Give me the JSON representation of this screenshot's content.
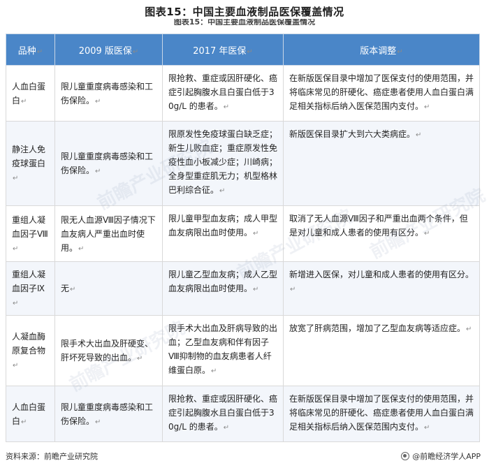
{
  "title": "图表15：中国主要血液制品医保覆盖情况",
  "subtitle": "图表15：中国主要血液制品医保覆盖情况",
  "table": {
    "headers": [
      "品种",
      "2009 版医保",
      "2017 年医保",
      "版本调整"
    ],
    "rows": [
      {
        "variety": "人血白蛋白",
        "v2009": "限儿童重度病毒感染和工伤保险。",
        "v2017": "限抢救、重症或因肝硬化、癌症引起胸腹水且白蛋白低于30g/L 的患者。",
        "change": "在新版医保目录中增加了医保支付的使用范围，并将临床常见的肝硬化、癌症患者使用人血白蛋白满足相关指标后纳入医保范围内支付。"
      },
      {
        "variety": "静注人免疫球蛋白",
        "v2009": "限儿童重度病毒感染和工伤保险。",
        "v2017": "限原发性免疫球蛋白缺乏症；新生儿败血症；重症原发性免疫性血小板减少症；川崎病；全身型重症肌无力；机型格林巴利综合征。",
        "change": "新版医保目录扩大到六大类病症。"
      },
      {
        "variety": "重组人凝血因子Ⅷ",
        "v2009": "限无人血源Ⅷ因子情况下血友病人严重出血时使用。",
        "v2017": "限儿童甲型血友病；成人甲型血友病限出血时使用。",
        "change": "取消了无人血源Ⅷ因子和严重出血两个条件，但是对儿童和成人患者的使用有区分。"
      },
      {
        "variety": "重组人凝血因子Ⅸ",
        "v2009": "无",
        "v2017": "限儿童乙型血友病；成人乙型血友病限出血时使用。",
        "change": "新增进入医保，对儿童和成人患者的使用有区分。"
      },
      {
        "variety": "人凝血酶原复合物",
        "v2009": "限手术大出血及肝硬变、肝坏死导致的出血。",
        "v2017": "限手术大出血及肝病导致的出血；乙型血友病和伴有因子Ⅷ抑制物的血友病患者人纤维蛋白原。",
        "change": "放宽了肝病范围，增加了乙型血友病等适应症。"
      },
      {
        "variety": "人血白蛋白",
        "v2009": "限儿童重度病毒感染和工伤保险。",
        "v2017": "限抢救、重症或因肝硬化、癌症引起胸腹水且白蛋白低于30g/L 的患者。",
        "change": "在新版医保目录中增加了医保支付的使用范围，并将临床常见的肝硬化、癌症患者使用人血白蛋白满足相关指标后纳入医保范围内支付。"
      }
    ]
  },
  "footer": {
    "source": "资料来源：前瞻产业研究院",
    "brand": "@前瞻经济学人APP"
  },
  "watermark_text": "前瞻产业研究院"
}
